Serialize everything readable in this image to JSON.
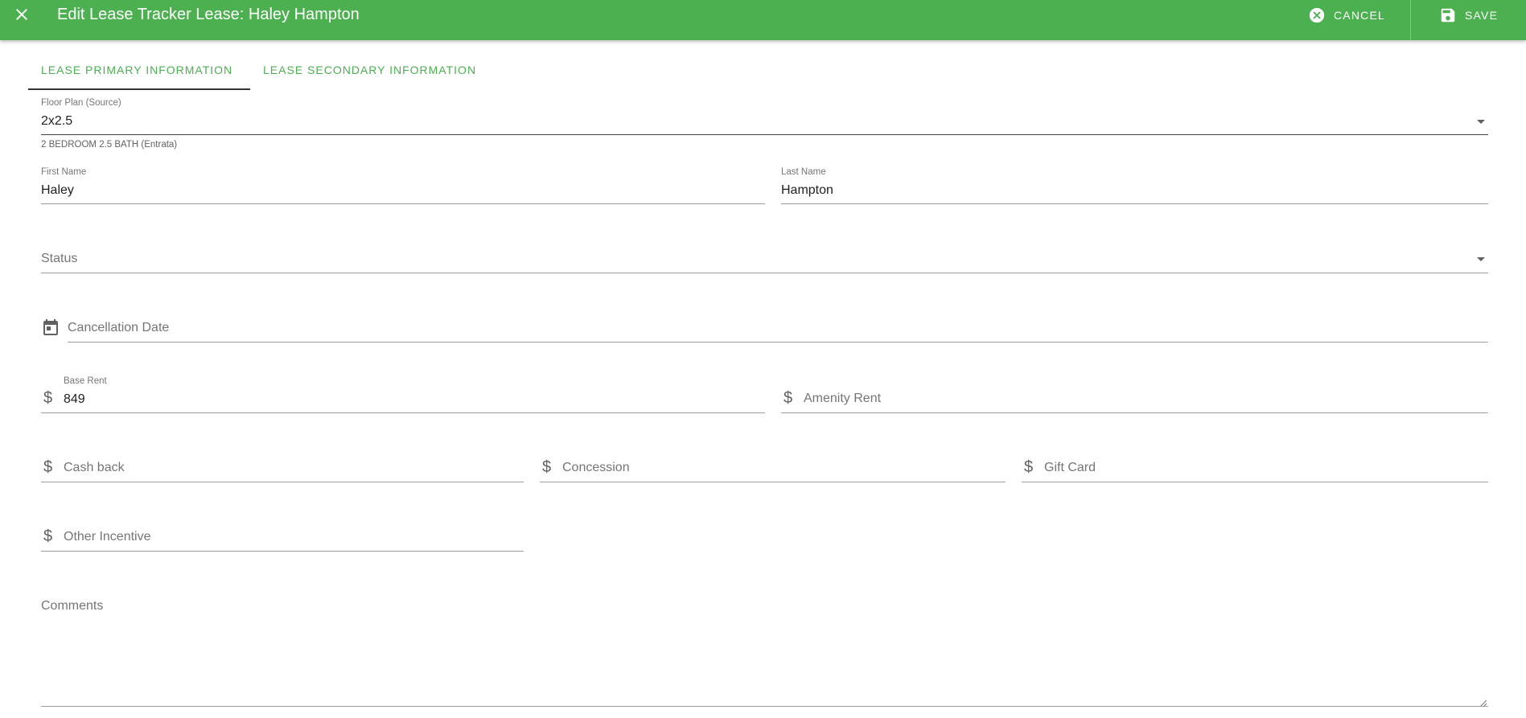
{
  "header": {
    "title": "Edit Lease Tracker Lease: Haley Hampton",
    "close_icon": "close-icon",
    "cancel_label": "CANCEL",
    "cancel_icon": "cancel-circle-icon",
    "save_label": "SAVE",
    "save_icon": "floppy-disk-icon",
    "background_color": "#4caf50"
  },
  "tabs": [
    {
      "label": "LEASE PRIMARY INFORMATION",
      "active": true
    },
    {
      "label": "LEASE SECONDARY INFORMATION",
      "active": false
    }
  ],
  "form": {
    "floor_plan": {
      "label": "Floor Plan (Source)",
      "value": "2x2.5",
      "hint": "2 BEDROOM 2.5 BATH (Entrata)"
    },
    "first_name": {
      "label": "First Name",
      "value": "Haley"
    },
    "last_name": {
      "label": "Last Name",
      "value": "Hampton"
    },
    "status": {
      "placeholder": "Status",
      "value": ""
    },
    "cancellation_date": {
      "placeholder": "Cancellation Date",
      "icon": "calendar-icon"
    },
    "base_rent": {
      "label": "Base Rent",
      "value": "849",
      "prefix": "$"
    },
    "amenity_rent": {
      "placeholder": "Amenity Rent",
      "prefix": "$"
    },
    "cash_back": {
      "placeholder": "Cash back",
      "prefix": "$"
    },
    "concession": {
      "placeholder": "Concession",
      "prefix": "$"
    },
    "gift_card": {
      "placeholder": "Gift Card",
      "prefix": "$"
    },
    "other_incentive": {
      "placeholder": "Other Incentive",
      "prefix": "$"
    },
    "comments": {
      "placeholder": "Comments"
    }
  },
  "colors": {
    "accent": "#4caf50",
    "text": "#212121",
    "muted": "#757575"
  }
}
